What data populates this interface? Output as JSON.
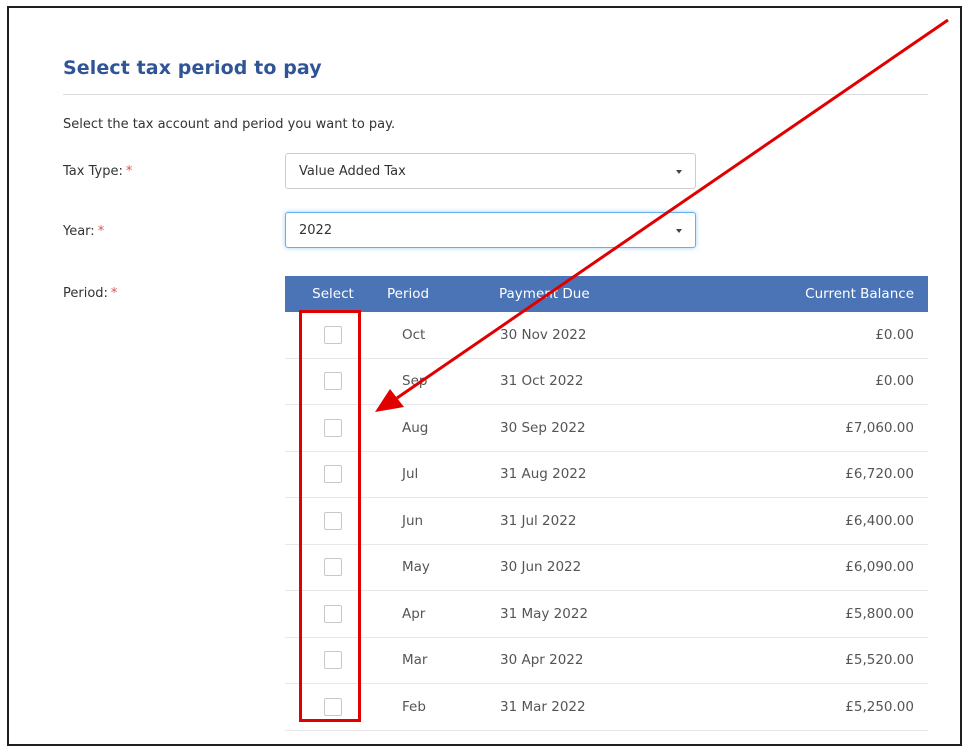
{
  "page": {
    "title": "Select tax period to pay",
    "intro": "Select the tax account and period you want to pay."
  },
  "form": {
    "tax_type": {
      "label": "Tax Type:",
      "required_mark": "*",
      "value": "Value Added Tax"
    },
    "year": {
      "label": "Year:",
      "required_mark": "*",
      "value": "2022"
    },
    "period": {
      "label": "Period:",
      "required_mark": "*"
    }
  },
  "table": {
    "headers": [
      "Select",
      "Period",
      "Payment Due",
      "Current Balance"
    ],
    "rows": [
      {
        "period": "Oct",
        "payment_due": "30 Nov 2022",
        "balance": "£0.00",
        "checked": false
      },
      {
        "period": "Sep",
        "payment_due": "31 Oct 2022",
        "balance": "£0.00",
        "checked": false
      },
      {
        "period": "Aug",
        "payment_due": "30 Sep 2022",
        "balance": "£7,060.00",
        "checked": false
      },
      {
        "period": "Jul",
        "payment_due": "31 Aug 2022",
        "balance": "£6,720.00",
        "checked": false
      },
      {
        "period": "Jun",
        "payment_due": "31 Jul 2022",
        "balance": "£6,400.00",
        "checked": false
      },
      {
        "period": "May",
        "payment_due": "30 Jun 2022",
        "balance": "£6,090.00",
        "checked": false
      },
      {
        "period": "Apr",
        "payment_due": "31 May 2022",
        "balance": "£5,800.00",
        "checked": false
      },
      {
        "period": "Mar",
        "payment_due": "30 Apr 2022",
        "balance": "£5,520.00",
        "checked": false
      },
      {
        "period": "Feb",
        "payment_due": "31 Mar 2022",
        "balance": "£5,250.00",
        "checked": false
      }
    ]
  },
  "colors": {
    "title": "#2f5597",
    "header_bg": "#4a74b5",
    "required": "#d9534f",
    "annotation": "#e00000"
  }
}
